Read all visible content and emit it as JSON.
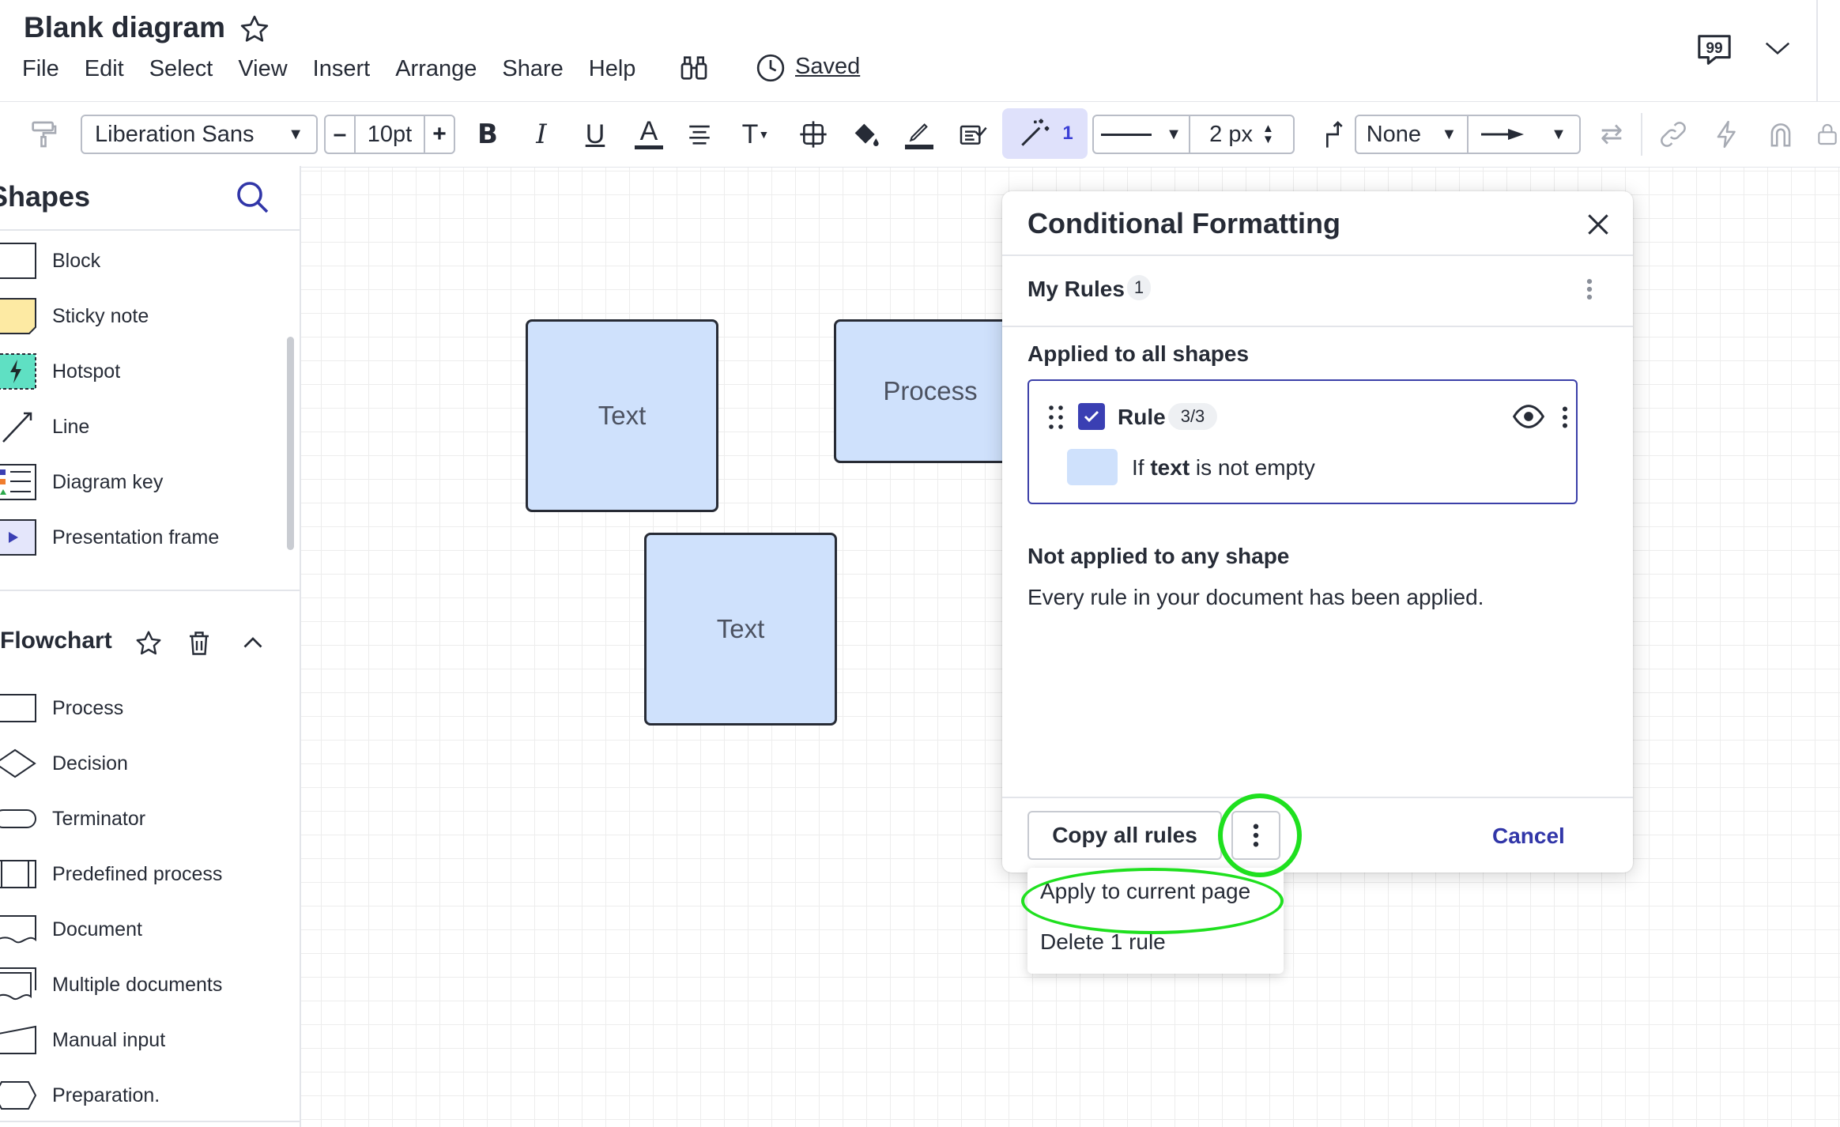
{
  "document": {
    "title": "Blank diagram",
    "status": "Saved"
  },
  "menu": [
    "File",
    "Edit",
    "Select",
    "View",
    "Insert",
    "Arrange",
    "Share",
    "Help"
  ],
  "toolbar": {
    "font_family": "Liberation Sans",
    "font_size": "10pt",
    "size_minus": "–",
    "size_plus": "+",
    "magic_count": "1",
    "line_width": "2 px",
    "arrow_start": "None"
  },
  "shapes_panel": {
    "heading": "Shapes",
    "items": [
      {
        "label": "Block",
        "icon": "block-icon"
      },
      {
        "label": "Sticky note",
        "icon": "sticky-note-icon"
      },
      {
        "label": "Hotspot",
        "icon": "hotspot-icon"
      },
      {
        "label": "Line",
        "icon": "line-icon"
      },
      {
        "label": "Diagram key",
        "icon": "diagram-key-icon"
      },
      {
        "label": "Presentation frame",
        "icon": "presentation-frame-icon"
      }
    ],
    "flowchart_heading": "Flowchart",
    "flowchart_items": [
      {
        "label": "Process",
        "icon": "process-icon"
      },
      {
        "label": "Decision",
        "icon": "decision-icon"
      },
      {
        "label": "Terminator",
        "icon": "terminator-icon"
      },
      {
        "label": "Predefined process",
        "icon": "predefined-process-icon"
      },
      {
        "label": "Document",
        "icon": "document-icon"
      },
      {
        "label": "Multiple documents",
        "icon": "multiple-documents-icon"
      },
      {
        "label": "Manual input",
        "icon": "manual-input-icon"
      },
      {
        "label": "Preparation.",
        "icon": "preparation-icon"
      }
    ]
  },
  "canvas": {
    "shapes": [
      {
        "text": "Text"
      },
      {
        "text": "Process"
      },
      {
        "text": "Text"
      }
    ]
  },
  "conditional_formatting": {
    "title": "Conditional Formatting",
    "my_rules_label": "My Rules",
    "my_rules_count": "1",
    "applied_heading": "Applied to all shapes",
    "rule": {
      "name": "Rule 1",
      "count": "3/3",
      "checked": true,
      "condition_prefix": "If",
      "condition_field": "text",
      "condition_suffix": "is not empty",
      "swatch_color": "#cfe1fc"
    },
    "not_applied_heading": "Not applied to any shape",
    "not_applied_text": "Every rule in your document has been applied.",
    "copy_button": "Copy all rules",
    "cancel_button": "Cancel",
    "dropdown": [
      "Apply to current page",
      "Delete 1 rule"
    ]
  },
  "colors": {
    "accent": "#3a3fb3",
    "shape_fill": "#cfe1fc",
    "highlight": "#1fe01f"
  }
}
